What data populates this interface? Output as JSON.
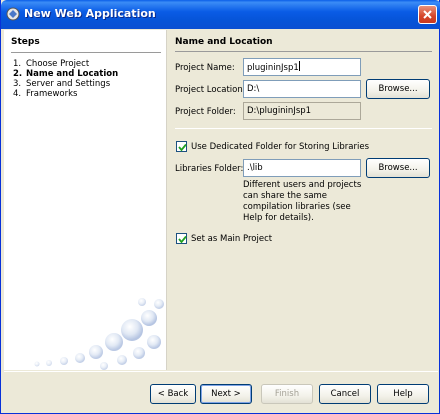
{
  "window": {
    "title": "New Web Application",
    "accent": "#0a5ce6"
  },
  "steps": {
    "title": "Steps",
    "items": [
      {
        "num": "1.",
        "label": "Choose Project"
      },
      {
        "num": "2.",
        "label": "Name and Location"
      },
      {
        "num": "3.",
        "label": "Server and Settings"
      },
      {
        "num": "4.",
        "label": "Frameworks"
      }
    ]
  },
  "form": {
    "section_title": "Name and Location",
    "project_name_label": "Project Name:",
    "project_name_value": "plugininJsp1",
    "project_location_label": "Project Location:",
    "project_location_value": "D:\\",
    "project_folder_label": "Project Folder:",
    "project_folder_value": "D:\\plugininJsp1",
    "browse_label": "Browse...",
    "dedicated_folder_label": "Use Dedicated Folder for Storing Libraries",
    "libraries_folder_label": "Libraries Folder:",
    "libraries_folder_value": ".\\lib",
    "help_text": "Different users and projects can share the same compilation libraries (see Help for details).",
    "main_project_label": "Set as Main Project"
  },
  "footer": {
    "back": "< Back",
    "next": "Next >",
    "finish": "Finish",
    "cancel": "Cancel",
    "help": "Help"
  }
}
